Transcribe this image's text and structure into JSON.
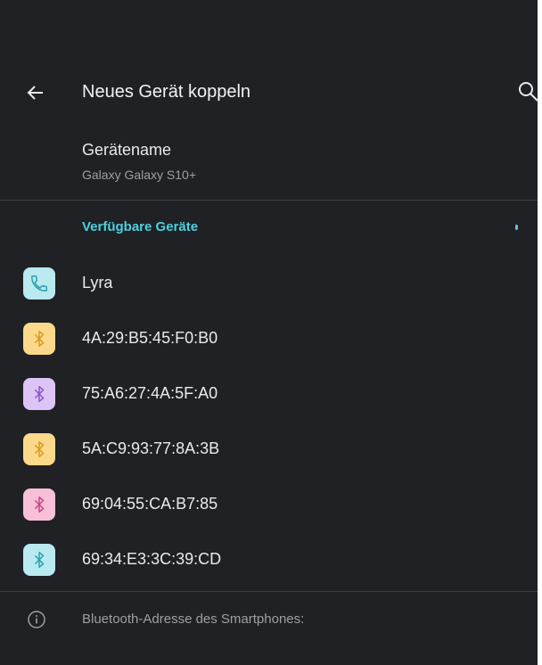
{
  "appbar": {
    "title": "Neues Gerät koppeln",
    "back_icon": "arrow-left-icon",
    "search_icon": "search-icon"
  },
  "device_name": {
    "label": "Gerätename",
    "value": "Galaxy Galaxy S10+"
  },
  "section": {
    "title": "Verfügbare Geräte"
  },
  "devices": [
    {
      "name": "Lyra",
      "icon": "phone-icon",
      "bg": "#b8eaf0",
      "fg": "#2a9fb0"
    },
    {
      "name": "4A:29:B5:45:F0:B0",
      "icon": "bluetooth-icon",
      "bg": "#fbd98a",
      "fg": "#d89a20"
    },
    {
      "name": "75:A6:27:4A:5F:A0",
      "icon": "bluetooth-icon",
      "bg": "#dcc4f6",
      "fg": "#8a55c8"
    },
    {
      "name": "5A:C9:93:77:8A:3B",
      "icon": "bluetooth-icon",
      "bg": "#fbd98a",
      "fg": "#d89a20"
    },
    {
      "name": "69:04:55:CA:B7:85",
      "icon": "bluetooth-icon",
      "bg": "#f7bfd8",
      "fg": "#c94680"
    },
    {
      "name": "69:34:E3:3C:39:CD",
      "icon": "bluetooth-icon",
      "bg": "#b8eaf0",
      "fg": "#2a9fb0"
    }
  ],
  "footer": {
    "info_icon": "info-icon",
    "text": "Bluetooth-Adresse des Smartphones:"
  },
  "colors": {
    "background": "#202124",
    "accent": "#4dd0e1",
    "text_secondary": "#9aa0a6"
  }
}
